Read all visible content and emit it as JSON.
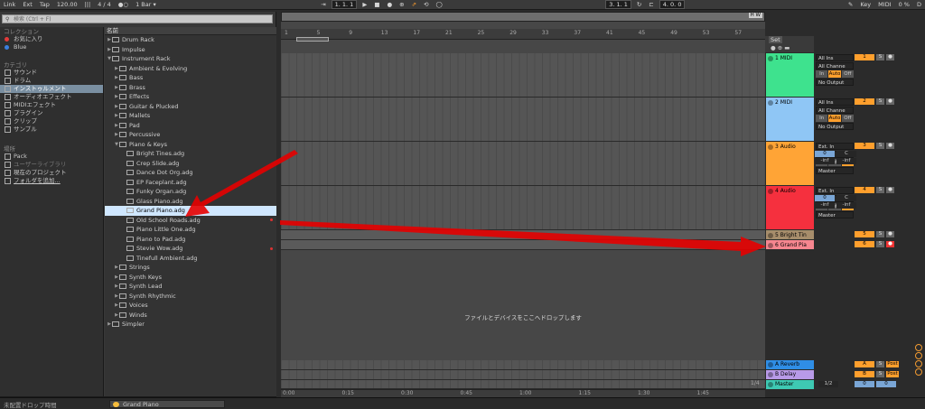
{
  "topbar": {
    "link": "Link",
    "ext": "Ext",
    "tap": "Tap",
    "tempo": "120.00",
    "signature": "4 / 4",
    "metronome": "●○",
    "quantize": "1 Bar ▾",
    "position": "1.  1.  1",
    "loop_start": "3.  1.  1",
    "loop_length": "4.  0.  0",
    "key": "Key",
    "midi": "MIDI",
    "cpu": "0 %",
    "d": "D"
  },
  "browser": {
    "search_placeholder": "検索 (Ctrl + F)",
    "collections_label": "コレクション",
    "collections": [
      {
        "label": "お気に入り",
        "color": "#e33b3b"
      },
      {
        "label": "Blue",
        "color": "#3a7fe0"
      }
    ],
    "categories_label": "カテゴリ",
    "categories": [
      {
        "label": "サウンド",
        "icon": "speaker-icon"
      },
      {
        "label": "ドラム",
        "icon": "drum-icon"
      },
      {
        "label": "インストゥルメント",
        "icon": "instrument-icon",
        "selected": true
      },
      {
        "label": "オーディオエフェクト",
        "icon": "audio-effect-icon"
      },
      {
        "label": "MIDIエフェクト",
        "icon": "midi-effect-icon"
      },
      {
        "label": "プラグイン",
        "icon": "plugin-icon"
      },
      {
        "label": "クリップ",
        "icon": "clip-icon"
      },
      {
        "label": "サンプル",
        "icon": "sample-icon"
      }
    ],
    "places_label": "場所",
    "places": [
      {
        "label": "Pack",
        "icon": "pack-icon"
      },
      {
        "label": "ユーザーライブラリ",
        "icon": "user-library-icon"
      },
      {
        "label": "現在のプロジェクト",
        "icon": "project-icon"
      },
      {
        "label": "フォルダを追加...",
        "icon": "add-folder-icon"
      }
    ],
    "name_header": "名前",
    "files": [
      {
        "label": "Drum Rack",
        "level": 0,
        "type": "folder",
        "expanded": false
      },
      {
        "label": "Impulse",
        "level": 0,
        "type": "folder",
        "expanded": false
      },
      {
        "label": "Instrument Rack",
        "level": 0,
        "type": "folder",
        "expanded": true
      },
      {
        "label": "Ambient & Evolving",
        "level": 1,
        "type": "folder",
        "expanded": false
      },
      {
        "label": "Bass",
        "level": 1,
        "type": "folder",
        "expanded": false
      },
      {
        "label": "Brass",
        "level": 1,
        "type": "folder",
        "expanded": false
      },
      {
        "label": "Effects",
        "level": 1,
        "type": "folder",
        "expanded": false
      },
      {
        "label": "Guitar & Plucked",
        "level": 1,
        "type": "folder",
        "expanded": false
      },
      {
        "label": "Mallets",
        "level": 1,
        "type": "folder",
        "expanded": false
      },
      {
        "label": "Pad",
        "level": 1,
        "type": "folder",
        "expanded": false
      },
      {
        "label": "Percussive",
        "level": 1,
        "type": "folder",
        "expanded": false
      },
      {
        "label": "Piano & Keys",
        "level": 1,
        "type": "folder",
        "expanded": true
      },
      {
        "label": "Bright Tines.adg",
        "level": 2,
        "type": "file"
      },
      {
        "label": "Crep Slide.adg",
        "level": 2,
        "type": "file"
      },
      {
        "label": "Dance Dot Org.adg",
        "level": 2,
        "type": "file"
      },
      {
        "label": "EP Faceplant.adg",
        "level": 2,
        "type": "file"
      },
      {
        "label": "Funky Organ.adg",
        "level": 2,
        "type": "file"
      },
      {
        "label": "Glass Piano.adg",
        "level": 2,
        "type": "file"
      },
      {
        "label": "Grand Piano.adg",
        "level": 2,
        "type": "file",
        "selected": true
      },
      {
        "label": "Old School Roads.adg",
        "level": 2,
        "type": "file",
        "dot": true
      },
      {
        "label": "Piano Little One.adg",
        "level": 2,
        "type": "file"
      },
      {
        "label": "Piano to Pad.adg",
        "level": 2,
        "type": "file"
      },
      {
        "label": "Stevie Wow.adg",
        "level": 2,
        "type": "file",
        "dot": true
      },
      {
        "label": "Tinefull Ambient.adg",
        "level": 2,
        "type": "file"
      },
      {
        "label": "Strings",
        "level": 1,
        "type": "folder",
        "expanded": false
      },
      {
        "label": "Synth Keys",
        "level": 1,
        "type": "folder",
        "expanded": false
      },
      {
        "label": "Synth Lead",
        "level": 1,
        "type": "folder",
        "expanded": false
      },
      {
        "label": "Synth Rhythmic",
        "level": 1,
        "type": "folder",
        "expanded": false
      },
      {
        "label": "Voices",
        "level": 1,
        "type": "folder",
        "expanded": false
      },
      {
        "label": "Winds",
        "level": 1,
        "type": "folder",
        "expanded": false
      },
      {
        "label": "Simpler",
        "level": 0,
        "type": "folder",
        "expanded": false
      }
    ]
  },
  "arrangement": {
    "ruler_ticks": [
      "1",
      "5",
      "9",
      "13",
      "17",
      "21",
      "25",
      "29",
      "33",
      "37",
      "41",
      "45",
      "49",
      "53",
      "57"
    ],
    "time_ticks": [
      "0:00",
      "0:15",
      "0:30",
      "0:45",
      "1:00",
      "1:15",
      "1:30",
      "1:45"
    ],
    "drop_text": "ファイルとデバイスをここへドロップします",
    "page_indicator": "1/4",
    "set_label": "Set",
    "hw_label": "H W"
  },
  "tracks": [
    {
      "name": "1 MIDI",
      "color": "#3ee28e",
      "height": 49,
      "input": "All Ins",
      "channel": "All Channe",
      "output": "No Output",
      "num": "1",
      "type": "midi"
    },
    {
      "name": "2 MIDI",
      "color": "#8fc6f5",
      "height": 49,
      "input": "All Ins",
      "channel": "All Channe",
      "output": "No Output",
      "num": "2",
      "type": "midi"
    },
    {
      "name": "3 Audio",
      "color": "#ffa436",
      "height": 49,
      "input": "Ext. In",
      "channel": "1",
      "output": "Master",
      "num": "3",
      "type": "audio",
      "vol": "0",
      "pan": "C",
      "inf1": "-inf",
      "inf2": "-inf"
    },
    {
      "name": "4 Audio",
      "color": "#f5303e",
      "height": 49,
      "input": "Ext. In",
      "channel": "2",
      "output": "Master",
      "num": "4",
      "type": "audio",
      "vol": "0",
      "pan": "C",
      "inf1": "-inf",
      "inf2": "-inf"
    },
    {
      "name": "5 Bright Tin",
      "color": "#a78d6b",
      "height": 11,
      "num": "5",
      "type": "small"
    },
    {
      "name": "6 Grand Pia",
      "color": "#f6868f",
      "height": 11,
      "num": "6",
      "type": "small",
      "armed": true
    }
  ],
  "returns": [
    {
      "name": "A Reverb",
      "color": "#2f8ee6",
      "num": "A",
      "post": "Post"
    },
    {
      "name": "B Delay",
      "color": "#b89ae8",
      "num": "B",
      "post": "Post"
    }
  ],
  "master": {
    "name": "Master",
    "color": "#3ec9b3",
    "quant": "1/2",
    "vol": "0",
    "pan": "0"
  },
  "monitor": {
    "in": "In",
    "auto": "Auto",
    "off": "Off"
  },
  "bottom": {
    "left_status": "未配置ドロップ時間",
    "clip_name": "Grand Piano"
  }
}
